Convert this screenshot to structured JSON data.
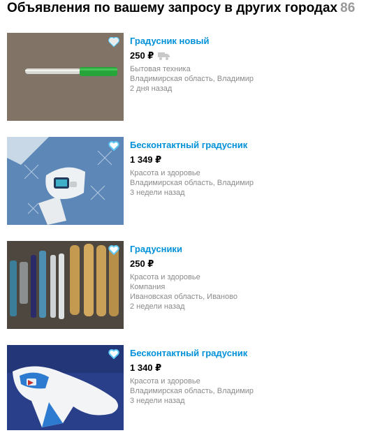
{
  "header": {
    "title": "Объявления по вашему запросу в других городах",
    "count": "86"
  },
  "listings": [
    {
      "title": "Градусник новый",
      "price": "250 ₽",
      "delivery_icon": "truck-icon",
      "category": "Бытовая техника",
      "location": "Владимирская область, Владимир",
      "date": "2 дня назад"
    },
    {
      "title": "Бесконтактный градусник",
      "price": "1 349 ₽",
      "category": "Красота и здоровье",
      "location": "Владимирская область, Владимир",
      "date": "3 недели назад"
    },
    {
      "title": "Градусники",
      "price": "250 ₽",
      "category": "Красота и здоровье",
      "seller": "Компания",
      "location": "Ивановская область, Иваново",
      "date": "2 недели назад"
    },
    {
      "title": "Бесконтактный градусник",
      "price": "1 340 ₽",
      "category": "Красота и здоровье",
      "location": "Владимирская область, Владимир",
      "date": "3 недели назад"
    }
  ],
  "colors": {
    "link": "#0091d9",
    "meta": "#8a8a8a",
    "count": "#999999",
    "favorite": "#5fc8f5"
  }
}
